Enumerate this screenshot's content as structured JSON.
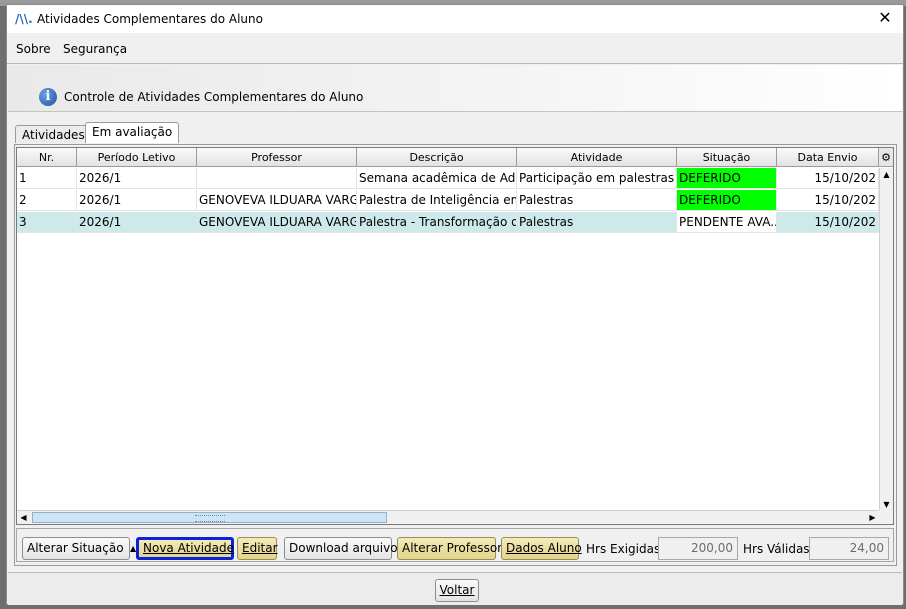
{
  "window": {
    "title": "Atividades Complementares do Aluno",
    "close_glyph": "✕"
  },
  "menu": {
    "items": [
      {
        "label": "Sobre"
      },
      {
        "label": "Segurança"
      }
    ]
  },
  "header": {
    "text": "Controle de Atividades Complementares do Aluno",
    "icon": "info-icon"
  },
  "tabs": [
    {
      "label": "Atividades",
      "active": false
    },
    {
      "label": "Em avaliação",
      "active": true
    }
  ],
  "table": {
    "columns": [
      "Nr.",
      "Período Letivo",
      "Professor",
      "Descrição",
      "Atividade",
      "Situação",
      "Data Envio"
    ],
    "rows": [
      {
        "nr": "1",
        "periodo": "2026/1",
        "professor": "",
        "descricao": "Semana acadêmica de Adm...",
        "atividade": "Participação em palestras e ...",
        "situacao": "DEFERIDO",
        "data_envio": "15/10/202"
      },
      {
        "nr": "2",
        "periodo": "2026/1",
        "professor": "GENOVEVA ILDUARA VARG...",
        "descricao": "Palestra de Inteligência emo...",
        "atividade": "Palestras",
        "situacao": "DEFERIDO",
        "data_envio": "15/10/202"
      },
      {
        "nr": "3",
        "periodo": "2026/1",
        "professor": "GENOVEVA ILDUARA VARG...",
        "descricao": "Palestra - Transformação di...",
        "atividade": "Palestras",
        "situacao": "PENDENTE AVA...",
        "data_envio": "15/10/202"
      }
    ],
    "selected_row": 3,
    "status_colors": {
      "DEFERIDO": "#00ff00"
    },
    "selection_color": "#cde9e9"
  },
  "actions": {
    "alterar_situacao": "Alterar Situação",
    "nova_atividade": "Nova Atividade",
    "editar": "Editar",
    "download": "Download arquivo",
    "alterar_professor": "Alterar Professor",
    "dados_aluno": "Dados Aluno",
    "hrs_exigidas_label": "Hrs Exigidas:",
    "hrs_exigidas_value": "200,00",
    "hrs_validas_label": "Hrs Válidas:",
    "hrs_validas_value": "24,00"
  },
  "footer": {
    "voltar": "Voltar"
  }
}
